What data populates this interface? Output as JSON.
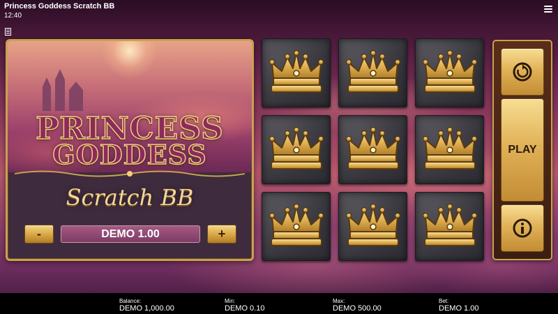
{
  "app": {
    "title": "Princess Goddess Scratch BB",
    "time": "12:40"
  },
  "logo": {
    "line1": "PRINCESS",
    "line2": "GODDESS",
    "subtitle": "Scratch BB"
  },
  "stake": {
    "minus_label": "-",
    "value": "DEMO 1.00",
    "plus_label": "+"
  },
  "grid": {
    "symbol": "crown-icon",
    "tiles": [
      "crown",
      "crown",
      "crown",
      "crown",
      "crown",
      "crown",
      "crown",
      "crown",
      "crown"
    ]
  },
  "controls": {
    "autoplay_icon": "autoplay-icon",
    "play_label": "PLAY",
    "info_icon": "info-icon"
  },
  "footer": {
    "balance_label": "Balance:",
    "balance_value": "DEMO 1,000.00",
    "min_label": "Min:",
    "min_value": "DEMO 0.10",
    "max_label": "Max:",
    "max_value": "DEMO 500.00",
    "bet_label": "Bet:",
    "bet_value": "DEMO 1.00"
  },
  "colors": {
    "gold": "#d8a443",
    "panel_border": "#c9a14e",
    "tile_dark": "#3b3a40",
    "footer_bg": "#000000"
  }
}
